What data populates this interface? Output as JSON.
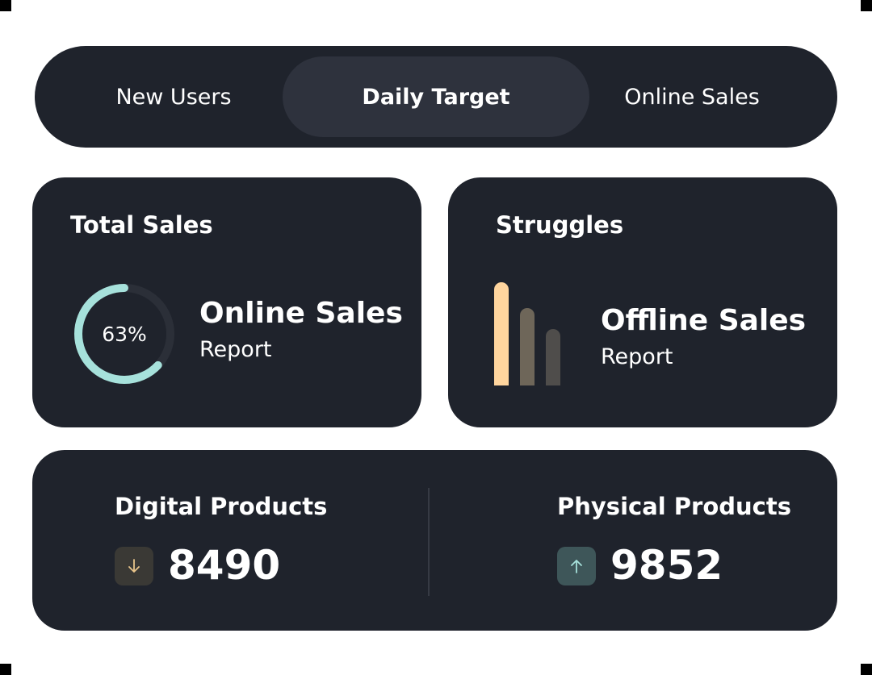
{
  "tabs": [
    {
      "label": "New Users",
      "active": false
    },
    {
      "label": "Daily Target",
      "active": true
    },
    {
      "label": "Online Sales",
      "active": false
    }
  ],
  "total_sales": {
    "title": "Total Sales",
    "percent": 63,
    "percent_label": "63%",
    "report_title": "Online Sales",
    "report_subtitle": "Report",
    "ring_color": "#a6e1db",
    "track_color": "#2b2f38"
  },
  "struggles": {
    "title": "Struggles",
    "bars": [
      {
        "value": 1.0,
        "color": "#ffd59e"
      },
      {
        "value": 0.75,
        "color": "#6e6659"
      },
      {
        "value": 0.55,
        "color": "#4f4d4b"
      }
    ],
    "report_title": "Offline Sales",
    "report_subtitle": "Report"
  },
  "products": {
    "digital": {
      "title": "Digital Products",
      "value": "8490",
      "trend": "down",
      "icon": "arrow-down-icon",
      "icon_color": "#e8c48a"
    },
    "physical": {
      "title": "Physical Products",
      "value": "9852",
      "trend": "up",
      "icon": "arrow-up-icon",
      "icon_color": "#a6e1db"
    }
  },
  "colors": {
    "background": "#ffffff",
    "card": "#1f232c",
    "active_tab": "#2e323d",
    "text": "#ffffff"
  }
}
